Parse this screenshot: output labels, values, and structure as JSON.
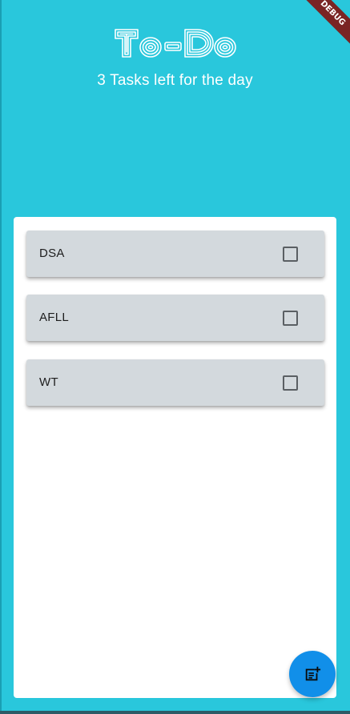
{
  "app": {
    "title": "To-Do",
    "subtitle": "3 Tasks left for the day",
    "debug_banner": "DEBUG"
  },
  "tasks": [
    {
      "label": "DSA",
      "checked": false
    },
    {
      "label": "AFLL",
      "checked": false
    },
    {
      "label": "WT",
      "checked": false
    }
  ],
  "fab": {
    "icon": "note-add-icon"
  },
  "colors": {
    "background": "#29c7dc",
    "panel": "#ffffff",
    "task_card": "#d3d9dd",
    "fab": "#118fe9",
    "debug_banner": "#7a2424"
  }
}
